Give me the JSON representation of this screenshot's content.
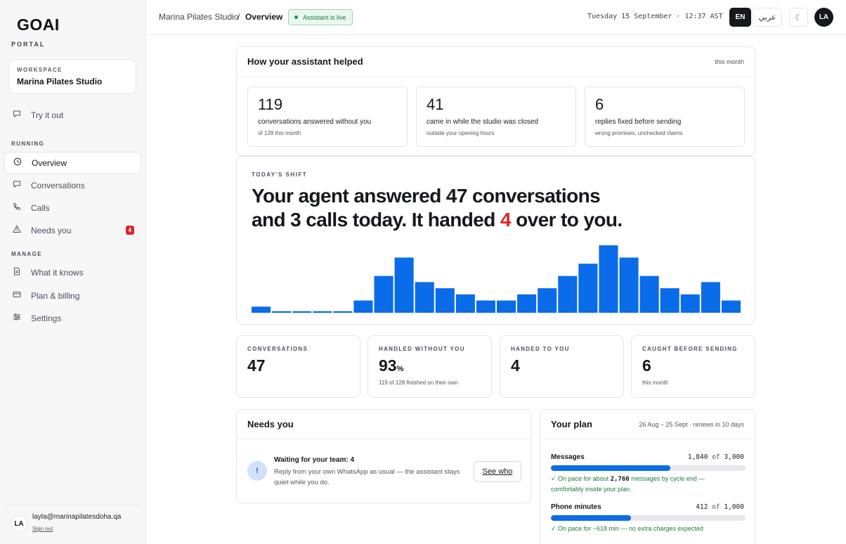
{
  "sidebar": {
    "logo": "GOAI",
    "portal": "PORTAL",
    "workspace_label": "WORKSPACE",
    "workspace_name": "Marina Pilates Studio",
    "try_it_out": "Try it out",
    "running_label": "RUNNING",
    "running_items": [
      {
        "label": "Overview",
        "icon": "clock-icon"
      },
      {
        "label": "Conversations",
        "icon": "chat-icon"
      },
      {
        "label": "Calls",
        "icon": "phone-icon"
      },
      {
        "label": "Needs you",
        "icon": "warning-icon",
        "badge": "4"
      }
    ],
    "manage_label": "MANAGE",
    "manage_items": [
      {
        "label": "What it knows",
        "icon": "document-icon"
      },
      {
        "label": "Plan & billing",
        "icon": "card-icon"
      },
      {
        "label": "Settings",
        "icon": "sliders-icon"
      }
    ],
    "user_initials": "LA",
    "user_email": "layla@marinapilatesdoha.qa",
    "sign_out": "Sign out"
  },
  "topbar": {
    "crumb_workspace": "Marina Pilates Studio",
    "crumb_sep": "/",
    "crumb_page": "Overview",
    "live_status": "Assistant is live",
    "datetime": "Tuesday 15 September · 12:37 AST",
    "lang_en": "EN",
    "lang_ar": "عربي",
    "theme_icon": "☾",
    "avatar": "LA"
  },
  "helped": {
    "title": "How your assistant helped",
    "period": "this month",
    "cards": [
      {
        "value": "119",
        "line1": "conversations answered without you",
        "line2": "of 128 this month"
      },
      {
        "value": "41",
        "line1": "came in while the studio was closed",
        "line2": "outside your opening hours"
      },
      {
        "value": "6",
        "line1": "replies fixed before sending",
        "line2": "wrong promises, unchecked claims"
      }
    ]
  },
  "shift": {
    "label": "TODAY'S SHIFT",
    "h1": "Your agent answered 47 conversations",
    "h2a": "and 3 calls today. It handed ",
    "h2num": "4",
    "h2b": " over to you."
  },
  "chart_data": {
    "type": "bar",
    "values": [
      2,
      0.5,
      0.5,
      0.5,
      0.5,
      4,
      12,
      18,
      10,
      8,
      6,
      4,
      4,
      6,
      8,
      12,
      16,
      22,
      18,
      12,
      8,
      6,
      10,
      4
    ],
    "ylim": [
      0,
      22
    ],
    "color": "#0a6ce8"
  },
  "stats": [
    {
      "label": "CONVERSATIONS",
      "value": "47",
      "suffix": "",
      "sub": ""
    },
    {
      "label": "HANDLED WITHOUT YOU",
      "value": "93",
      "suffix": "%",
      "sub": "119 of 128 finished on their own"
    },
    {
      "label": "HANDED TO YOU",
      "value": "4",
      "suffix": "",
      "sub": ""
    },
    {
      "label": "CAUGHT BEFORE SENDING",
      "value": "6",
      "suffix": "",
      "sub": "this month"
    }
  ],
  "needs": {
    "title": "Needs you",
    "item_title": "Waiting for your team: 4",
    "item_body": "Reply from your own WhatsApp as usual — the assistant stays quiet while you do.",
    "icon_text": "!",
    "button": "See who"
  },
  "plan": {
    "title": "Your plan",
    "period": "26 Aug – 25 Sept · renews in 10 days",
    "messages_label": "Messages",
    "messages_used": "1,840",
    "messages_of": "of",
    "messages_total": "3,000",
    "messages_progress": 0.613,
    "messages_note_a": "✓ On pace for about ",
    "messages_note_num": "2,760",
    "messages_note_b": " messages by cycle end — comfortably inside your plan.",
    "phone_label": "Phone minutes",
    "phone_used": "412",
    "phone_of": "of",
    "phone_total": "1,000",
    "phone_progress": 0.412,
    "phone_note": "✓ On pace for ~618 min — no extra charges expected"
  }
}
